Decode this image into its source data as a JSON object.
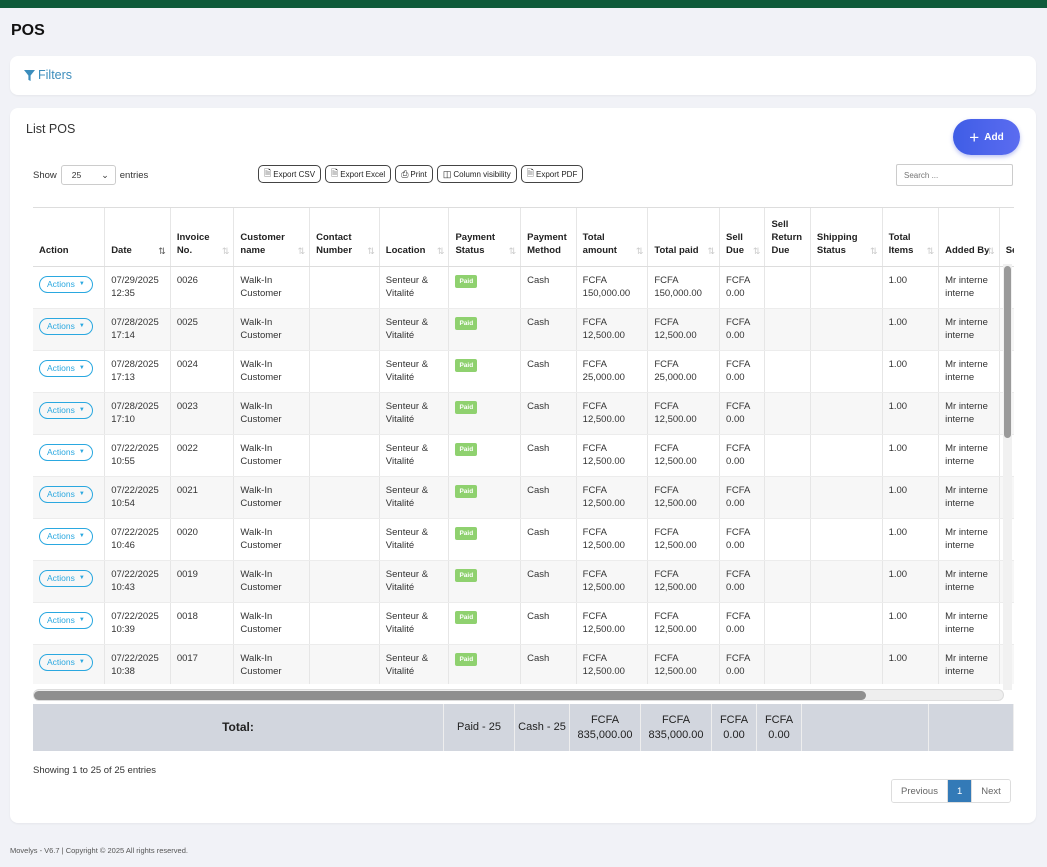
{
  "page": {
    "title": "POS",
    "footer": "Movelys - V6.7 | Copyright © 2025 All rights reserved."
  },
  "filters": {
    "label": "Filters",
    "icon": "filter-icon"
  },
  "card": {
    "title": "List POS",
    "add_label": "Add",
    "add_icon": "plus-icon"
  },
  "controls": {
    "show_label": "Show",
    "page_length": "25",
    "entries_label": "entries",
    "search_placeholder": "Search ...",
    "exports": [
      {
        "label": "Export CSV",
        "icon": "file-csv-icon"
      },
      {
        "label": "Export Excel",
        "icon": "file-excel-icon"
      },
      {
        "label": "Print",
        "icon": "print-icon"
      },
      {
        "label": "Column visibility",
        "icon": "columns-icon"
      },
      {
        "label": "Export PDF",
        "icon": "file-pdf-icon"
      }
    ]
  },
  "table": {
    "columns": [
      "Action",
      "Date",
      "Invoice No.",
      "Customer name",
      "Contact Number",
      "Location",
      "Payment Status",
      "Payment Method",
      "Total amount",
      "Total paid",
      "Sell Due",
      "Sell Return Due",
      "Shipping Status",
      "Total Items",
      "Added By",
      "Sell note"
    ],
    "action_label": "Actions",
    "rows": [
      {
        "date": "07/29/2025 12:35",
        "invoice": "0026",
        "customer": "Walk-In Customer",
        "contact": "",
        "location": "Senteur & Vitalité",
        "status": "Paid",
        "method": "Cash",
        "amount": "FCFA 150,000.00",
        "paid": "FCFA 150,000.00",
        "due": "FCFA 0.00",
        "return_due": "",
        "shipping": "",
        "items": "1.00",
        "added_by": "Mr interne interne"
      },
      {
        "date": "07/28/2025 17:14",
        "invoice": "0025",
        "customer": "Walk-In Customer",
        "contact": "",
        "location": "Senteur & Vitalité",
        "status": "Paid",
        "method": "Cash",
        "amount": "FCFA 12,500.00",
        "paid": "FCFA 12,500.00",
        "due": "FCFA 0.00",
        "return_due": "",
        "shipping": "",
        "items": "1.00",
        "added_by": "Mr interne interne"
      },
      {
        "date": "07/28/2025 17:13",
        "invoice": "0024",
        "customer": "Walk-In Customer",
        "contact": "",
        "location": "Senteur & Vitalité",
        "status": "Paid",
        "method": "Cash",
        "amount": "FCFA 25,000.00",
        "paid": "FCFA 25,000.00",
        "due": "FCFA 0.00",
        "return_due": "",
        "shipping": "",
        "items": "1.00",
        "added_by": "Mr interne interne"
      },
      {
        "date": "07/28/2025 17:10",
        "invoice": "0023",
        "customer": "Walk-In Customer",
        "contact": "",
        "location": "Senteur & Vitalité",
        "status": "Paid",
        "method": "Cash",
        "amount": "FCFA 12,500.00",
        "paid": "FCFA 12,500.00",
        "due": "FCFA 0.00",
        "return_due": "",
        "shipping": "",
        "items": "1.00",
        "added_by": "Mr interne interne"
      },
      {
        "date": "07/22/2025 10:55",
        "invoice": "0022",
        "customer": "Walk-In Customer",
        "contact": "",
        "location": "Senteur & Vitalité",
        "status": "Paid",
        "method": "Cash",
        "amount": "FCFA 12,500.00",
        "paid": "FCFA 12,500.00",
        "due": "FCFA 0.00",
        "return_due": "",
        "shipping": "",
        "items": "1.00",
        "added_by": "Mr interne interne"
      },
      {
        "date": "07/22/2025 10:54",
        "invoice": "0021",
        "customer": "Walk-In Customer",
        "contact": "",
        "location": "Senteur & Vitalité",
        "status": "Paid",
        "method": "Cash",
        "amount": "FCFA 12,500.00",
        "paid": "FCFA 12,500.00",
        "due": "FCFA 0.00",
        "return_due": "",
        "shipping": "",
        "items": "1.00",
        "added_by": "Mr interne interne"
      },
      {
        "date": "07/22/2025 10:46",
        "invoice": "0020",
        "customer": "Walk-In Customer",
        "contact": "",
        "location": "Senteur & Vitalité",
        "status": "Paid",
        "method": "Cash",
        "amount": "FCFA 12,500.00",
        "paid": "FCFA 12,500.00",
        "due": "FCFA 0.00",
        "return_due": "",
        "shipping": "",
        "items": "1.00",
        "added_by": "Mr interne interne"
      },
      {
        "date": "07/22/2025 10:43",
        "invoice": "0019",
        "customer": "Walk-In Customer",
        "contact": "",
        "location": "Senteur & Vitalité",
        "status": "Paid",
        "method": "Cash",
        "amount": "FCFA 12,500.00",
        "paid": "FCFA 12,500.00",
        "due": "FCFA 0.00",
        "return_due": "",
        "shipping": "",
        "items": "1.00",
        "added_by": "Mr interne interne"
      },
      {
        "date": "07/22/2025 10:39",
        "invoice": "0018",
        "customer": "Walk-In Customer",
        "contact": "",
        "location": "Senteur & Vitalité",
        "status": "Paid",
        "method": "Cash",
        "amount": "FCFA 12,500.00",
        "paid": "FCFA 12,500.00",
        "due": "FCFA 0.00",
        "return_due": "",
        "shipping": "",
        "items": "1.00",
        "added_by": "Mr interne interne"
      },
      {
        "date": "07/22/2025 10:38",
        "invoice": "0017",
        "customer": "Walk-In Customer",
        "contact": "",
        "location": "Senteur & Vitalité",
        "status": "Paid",
        "method": "Cash",
        "amount": "FCFA 12,500.00",
        "paid": "FCFA 12,500.00",
        "due": "FCFA 0.00",
        "return_due": "",
        "shipping": "",
        "items": "1.00",
        "added_by": "Mr interne interne"
      }
    ]
  },
  "totals": {
    "label": "Total:",
    "status": "Paid - 25",
    "method": "Cash - 25",
    "amount": "FCFA 835,000.00",
    "paid": "FCFA 835,000.00",
    "due": "FCFA 0.00",
    "return_due": "FCFA 0.00"
  },
  "pagination": {
    "info": "Showing 1 to 25 of 25 entries",
    "previous": "Previous",
    "current": "1",
    "next": "Next"
  },
  "colors": {
    "accent": "#3c8dbc",
    "add_button": "#4a5ee8",
    "paid_badge": "#8fd16f",
    "action_button": "#2aa8e0",
    "topbar": "#0e5a3a",
    "totals_bg": "#d2d6de"
  }
}
